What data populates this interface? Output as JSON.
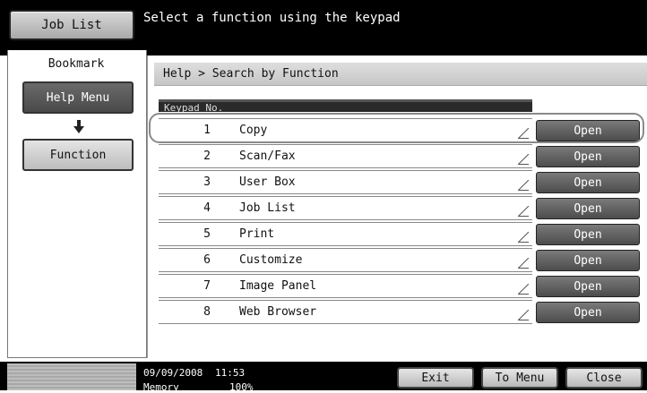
{
  "header": {
    "job_list_label": "Job List",
    "message": "Select a function using the keypad"
  },
  "sidebar": {
    "tab_label": "Bookmark",
    "help_menu_label": "Help Menu",
    "function_label": "Function"
  },
  "main": {
    "breadcrumb": "Help > Search by Function",
    "column_header": "Keypad No.",
    "rows": [
      {
        "num": "1",
        "label": "Copy",
        "action": "Open"
      },
      {
        "num": "2",
        "label": "Scan/Fax",
        "action": "Open"
      },
      {
        "num": "3",
        "label": "User Box",
        "action": "Open"
      },
      {
        "num": "4",
        "label": "Job List",
        "action": "Open"
      },
      {
        "num": "5",
        "label": "Print",
        "action": "Open"
      },
      {
        "num": "6",
        "label": "Customize",
        "action": "Open"
      },
      {
        "num": "7",
        "label": "Image Panel",
        "action": "Open"
      },
      {
        "num": "8",
        "label": "Web Browser",
        "action": "Open"
      }
    ]
  },
  "footer": {
    "date": "09/09/2008",
    "time": "11:53",
    "memory_label": "Memory",
    "memory_value": "100%",
    "exit_label": "Exit",
    "to_menu_label": "To Menu",
    "close_label": "Close"
  },
  "icons": {
    "down_arrow": "down-arrow-icon",
    "row_corner": "corner-indicator-icon"
  }
}
